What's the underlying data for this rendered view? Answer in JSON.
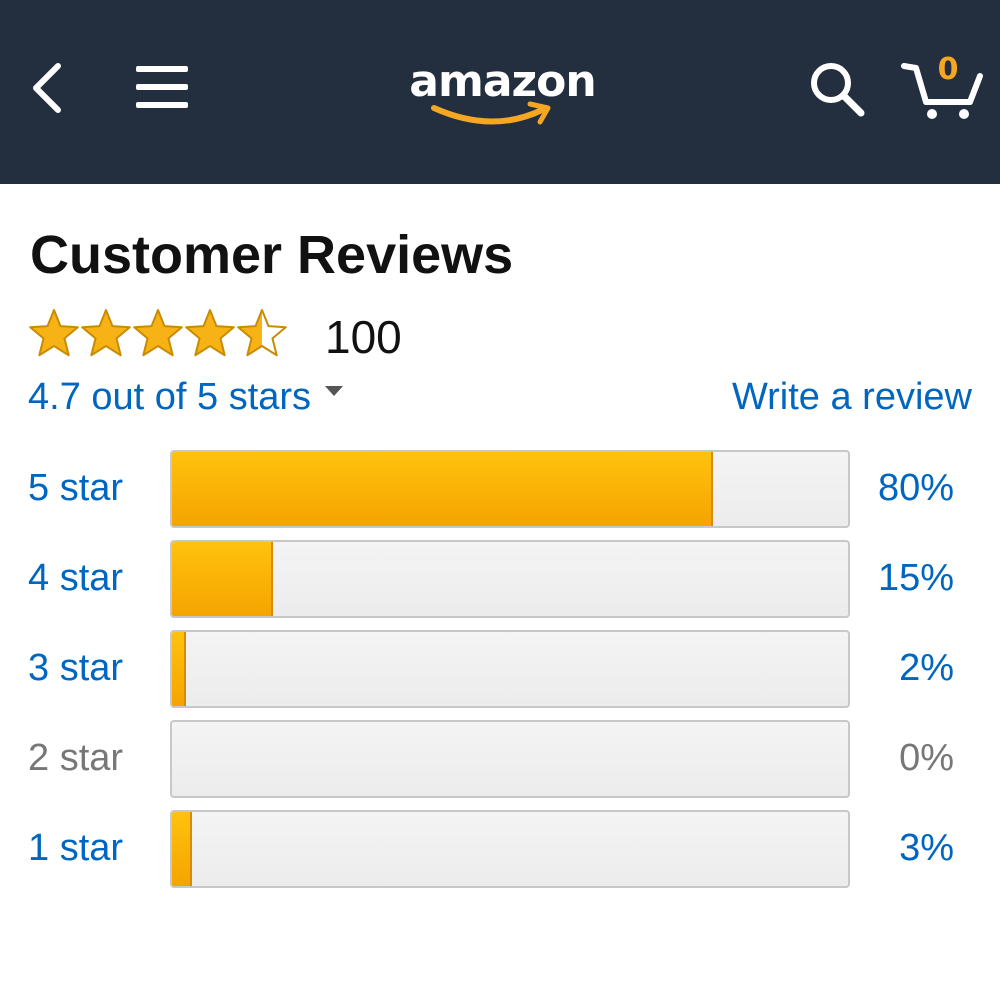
{
  "header": {
    "logo_text": "amazon",
    "cart_count": "0",
    "background_color": "#232f3e",
    "accent_color": "#f5a623"
  },
  "icons": {
    "back": "chevron-left-icon",
    "menu": "hamburger-menu-icon",
    "search": "search-icon",
    "cart": "cart-icon"
  },
  "reviews": {
    "title": "Customer Reviews",
    "star_rating": 4.7,
    "review_count": "100",
    "rating_text": "4.7 out of 5 stars",
    "write_review": "Write a review",
    "link_color": "#0066c0",
    "bar_color": "#f5a400",
    "breakdown": [
      {
        "label": "5 star",
        "percent_text": "80%",
        "percent": 80,
        "enabled": true
      },
      {
        "label": "4 star",
        "percent_text": "15%",
        "percent": 15,
        "enabled": true
      },
      {
        "label": "3 star",
        "percent_text": "2%",
        "percent": 2,
        "enabled": true
      },
      {
        "label": "2 star",
        "percent_text": "0%",
        "percent": 0,
        "enabled": false
      },
      {
        "label": "1 star",
        "percent_text": "3%",
        "percent": 3,
        "enabled": true
      }
    ]
  }
}
